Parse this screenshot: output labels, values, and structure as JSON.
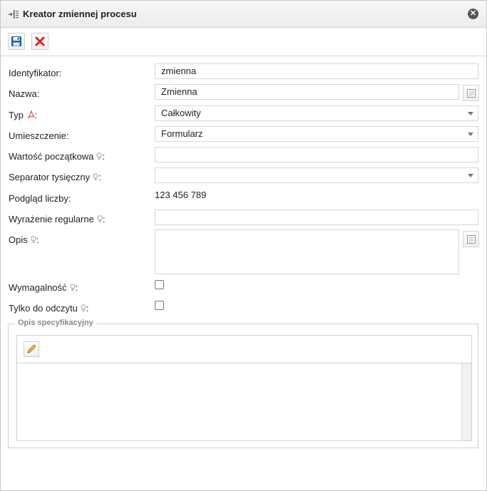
{
  "window": {
    "title": "Kreator zmiennej procesu",
    "title_icon": "variable-wizard-icon",
    "close_icon": "close-circle-icon"
  },
  "toolbar": {
    "save_icon": "floppy-save-icon",
    "cancel_icon": "red-x-cancel-icon"
  },
  "form": {
    "identifier": {
      "label": "Identyfikator:",
      "value": "zmienna"
    },
    "name": {
      "label": "Nazwa:",
      "value": "Zmienna"
    },
    "type": {
      "label_prefix": "Typ",
      "label_suffix": ":",
      "value": "Całkowity"
    },
    "placement": {
      "label": "Umieszczenie:",
      "value": "Formularz"
    },
    "initial_value": {
      "label_text": "Wartość początkowa",
      "label_suffix": ":",
      "value": ""
    },
    "thousand_separator": {
      "label_text": "Separator tysięczny",
      "label_suffix": ":",
      "value": ""
    },
    "number_preview": {
      "label": "Podgląd liczby:",
      "value": "123 456 789"
    },
    "regex": {
      "label_text": "Wyrażenie regularne",
      "label_suffix": ":",
      "value": ""
    },
    "description": {
      "label_text": "Opis",
      "label_suffix": ":",
      "value": ""
    },
    "required": {
      "label_text": "Wymagalność",
      "label_suffix": ":",
      "checked": false
    },
    "read_only": {
      "label_text": "Tylko do odczytu",
      "label_suffix": ":",
      "checked": false
    }
  },
  "spec": {
    "legend": "Opis specyfikacyjny",
    "edit_icon": "pencil-icon"
  },
  "colors": {
    "cancel_red": "#e02020",
    "save_blue": "#1f5fa8",
    "pdf_red": "#d9342b"
  }
}
